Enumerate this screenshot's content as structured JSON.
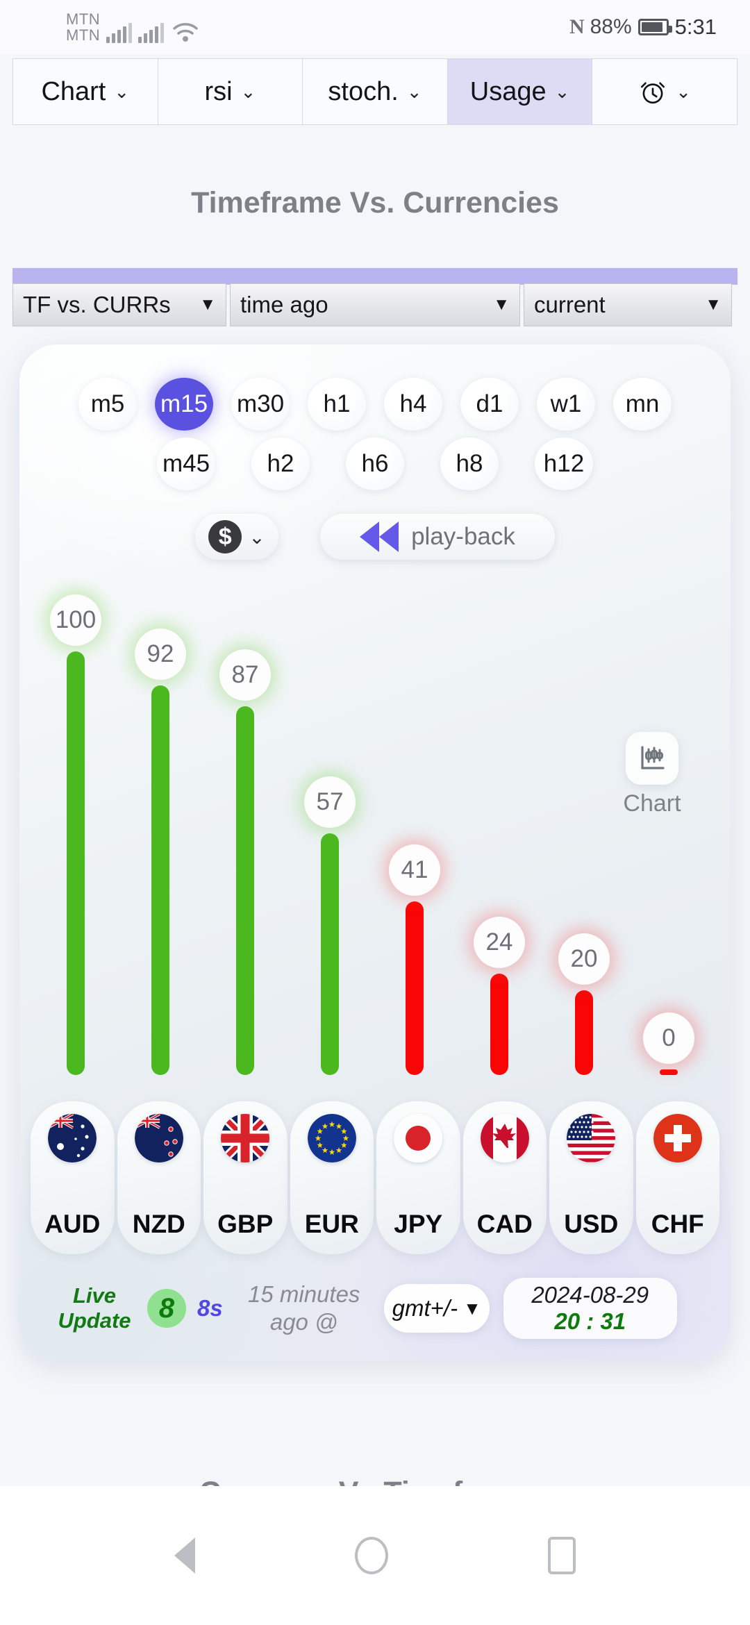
{
  "status_bar": {
    "carrier_line1": "MTN",
    "carrier_line2": "MTN",
    "nfc_icon": "nfc-icon",
    "battery_percent": "88%",
    "clock": "5:31"
  },
  "top_menu": {
    "tabs": [
      {
        "label": "Chart",
        "caret": "⌄",
        "active": false
      },
      {
        "label": "rsi",
        "caret": "⌄",
        "active": false
      },
      {
        "label": "stoch.",
        "caret": "⌄",
        "active": false
      },
      {
        "label": "Usage",
        "caret": "⌄",
        "active": true
      },
      {
        "label": "",
        "caret": "⌄",
        "active": false,
        "icon": "alarm-clock-icon"
      }
    ]
  },
  "titles": {
    "top": "Timeframe Vs. Currencies",
    "bottom": "Currency Vs Timeframes"
  },
  "selectors": {
    "mode": "TF vs. CURRs",
    "time": "time ago",
    "current": "current",
    "caret": "▼"
  },
  "timeframes": {
    "row1": [
      "m5",
      "m15",
      "m30",
      "h1",
      "h4",
      "d1",
      "w1",
      "mn"
    ],
    "row2": [
      "m45",
      "h2",
      "h6",
      "h8",
      "h12"
    ],
    "selected": "m15"
  },
  "controls": {
    "dollar_symbol": "$",
    "dollar_caret": "⌄",
    "playback_label": "play-back",
    "rewind_icon": "rewind-icon"
  },
  "chart_side_button": {
    "icon": "candlestick-chart-icon",
    "label": "Chart"
  },
  "footer": {
    "live_line1": "Live",
    "live_line2": "Update",
    "counter": "8",
    "seconds": "8s",
    "ago_line1": "15 minutes",
    "ago_line2": "ago @",
    "gmt_label": "gmt+/-",
    "gmt_caret": "▼",
    "date": "2024-08-29",
    "time": "20 : 31"
  },
  "nav_bar": {
    "back": "back-icon",
    "home": "home-icon",
    "recents": "recents-icon"
  },
  "colors": {
    "bar_up": "#4cb820",
    "bar_down": "#f90505",
    "accent": "#5b51e0",
    "selector_accent": "#b8b4f0",
    "green_text": "#127a12",
    "purple_text": "#5048e0"
  },
  "chart_data": {
    "type": "bar",
    "title": "Timeframe Vs. Currencies",
    "subtitle": "m15",
    "categories": [
      "AUD",
      "NZD",
      "GBP",
      "EUR",
      "JPY",
      "CAD",
      "USD",
      "CHF"
    ],
    "values": [
      100,
      92,
      87,
      57,
      41,
      24,
      20,
      0
    ],
    "directions": [
      "up",
      "up",
      "up",
      "up",
      "down",
      "down",
      "down",
      "down"
    ],
    "flags": [
      "au-flag",
      "nz-flag",
      "gb-flag",
      "eu-flag",
      "jp-flag",
      "ca-flag",
      "us-flag",
      "ch-flag"
    ],
    "ylim": [
      0,
      100
    ],
    "xlabel": "",
    "ylabel": "",
    "grid": false,
    "legend": "none"
  }
}
